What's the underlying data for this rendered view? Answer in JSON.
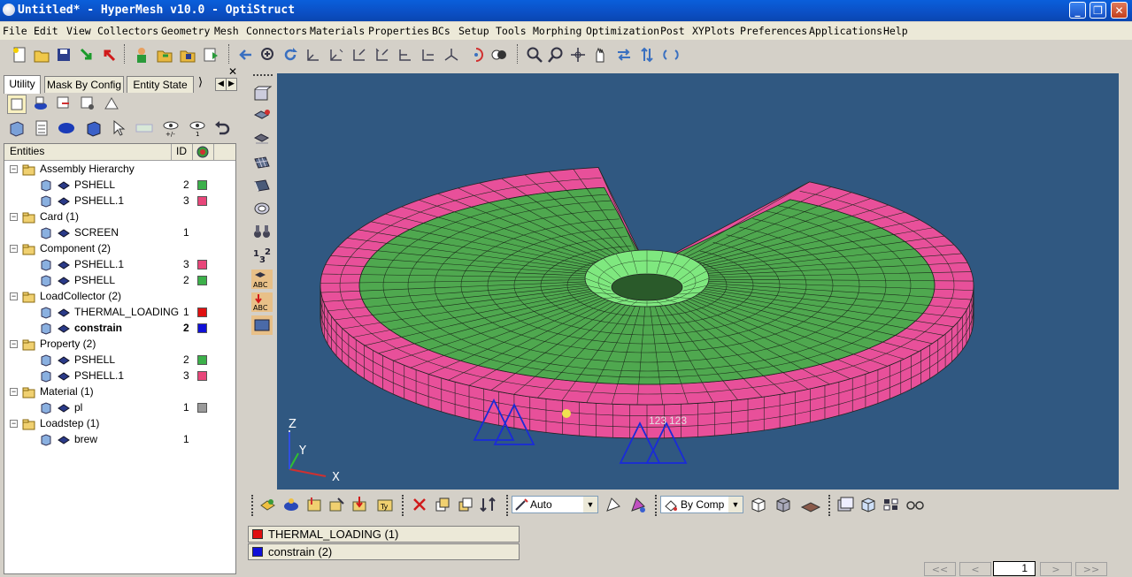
{
  "window": {
    "title": "Untitled* - HyperMesh v10.0 - OptiStruct"
  },
  "menu": [
    "File",
    "Edit",
    "View",
    "Collectors",
    "Geometry",
    "Mesh",
    "Connectors",
    "Materials",
    "Properties",
    "BCs",
    "Setup",
    "Tools",
    "Morphing",
    "Optimization",
    "Post",
    "XYPlots",
    "Preferences",
    "Applications",
    "Help"
  ],
  "tabs": [
    "Utility",
    "Mask By Config",
    "Entity State"
  ],
  "tree": {
    "headers": {
      "entities": "Entities",
      "id": "ID"
    },
    "rows": [
      {
        "label": "Assembly Hierarchy",
        "level": 0,
        "id": "",
        "color": ""
      },
      {
        "label": "PSHELL",
        "level": 1,
        "id": "2",
        "color": "#3cb04a"
      },
      {
        "label": "PSHELL.1",
        "level": 1,
        "id": "3",
        "color": "#e8467a"
      },
      {
        "label": "Card (1)",
        "level": 0,
        "id": "",
        "color": ""
      },
      {
        "label": "SCREEN",
        "level": 1,
        "id": "1",
        "color": ""
      },
      {
        "label": "Component (2)",
        "level": 0,
        "id": "",
        "color": ""
      },
      {
        "label": "PSHELL.1",
        "level": 1,
        "id": "3",
        "color": "#e8467a"
      },
      {
        "label": "PSHELL",
        "level": 1,
        "id": "2",
        "color": "#3cb04a"
      },
      {
        "label": "LoadCollector (2)",
        "level": 0,
        "id": "",
        "color": ""
      },
      {
        "label": "THERMAL_LOADING",
        "level": 1,
        "id": "1",
        "color": "#e01010"
      },
      {
        "label": "constrain",
        "level": 1,
        "id": "2",
        "color": "#1010d8"
      },
      {
        "label": "Property (2)",
        "level": 0,
        "id": "",
        "color": ""
      },
      {
        "label": "PSHELL",
        "level": 1,
        "id": "2",
        "color": "#3cb04a"
      },
      {
        "label": "PSHELL.1",
        "level": 1,
        "id": "3",
        "color": "#e8467a"
      },
      {
        "label": "Material (1)",
        "level": 0,
        "id": "",
        "color": ""
      },
      {
        "label": "pl",
        "level": 1,
        "id": "1",
        "color": "#9a9a9a"
      },
      {
        "label": "Loadstep (1)",
        "level": 0,
        "id": "",
        "color": ""
      },
      {
        "label": "brew",
        "level": 1,
        "id": "1",
        "color": ""
      }
    ]
  },
  "viewport": {
    "axis": {
      "x": "X",
      "y": "Y",
      "z": "Z"
    },
    "node_labels": [
      "123",
      "123"
    ],
    "colors": {
      "background": "#305881",
      "outer_ring": "#e8509a",
      "inner_mesh": "#4fa84f",
      "hole": "#7fe87f",
      "constraints": "#1a2bd8"
    }
  },
  "bottom_toolbar": {
    "display_mode": "Auto",
    "color_mode": "By Comp"
  },
  "load_list": [
    {
      "label": "THERMAL_LOADING (1)",
      "color": "#e01010"
    },
    {
      "label": "constrain (2)",
      "color": "#1010d8"
    }
  ],
  "pager": {
    "first": "<<",
    "prev": "<",
    "page": "1",
    "next": ">",
    "last": ">>"
  }
}
